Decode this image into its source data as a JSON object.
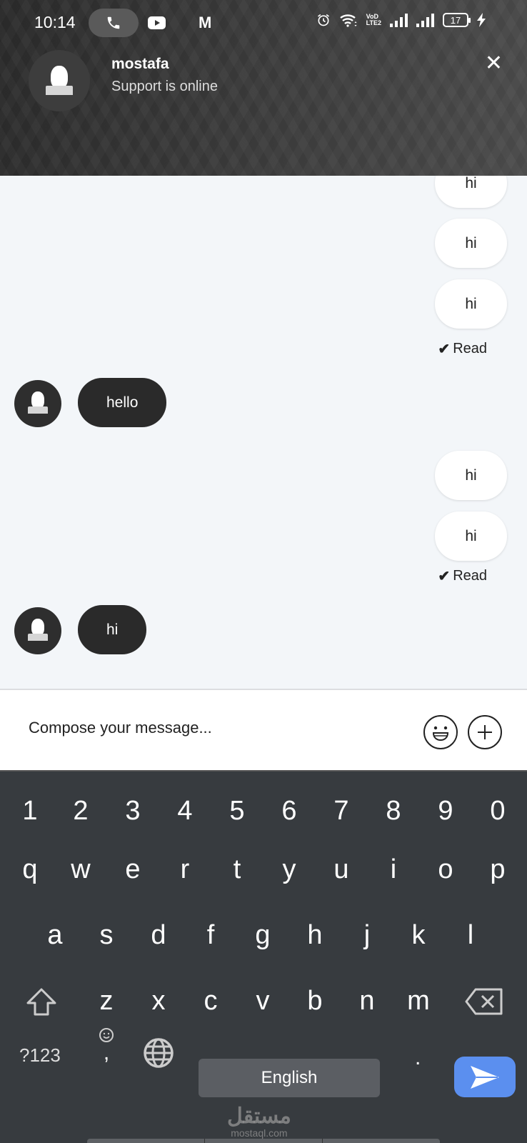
{
  "status_bar": {
    "time": "10:14",
    "left_icons": [
      "phone-call-icon",
      "youtube-icon",
      "gmail-icon"
    ],
    "right_icons": [
      "alarm-icon",
      "wifi-icon",
      "volte-icon",
      "signal-icon",
      "signal-icon",
      "battery-icon",
      "charging-icon"
    ],
    "volte_top": "VoD",
    "volte_bottom": "LTE2",
    "battery_level": "17"
  },
  "header": {
    "contact_name": "mostafa",
    "contact_status": "Support is online",
    "close_label": "✕"
  },
  "messages": [
    {
      "direction": "out",
      "text": "hi"
    },
    {
      "direction": "out",
      "text": "hi"
    },
    {
      "direction": "out",
      "text": "hi"
    },
    {
      "direction": "receipt",
      "text": "Read"
    },
    {
      "direction": "in",
      "text": "hello"
    },
    {
      "direction": "out",
      "text": "hi"
    },
    {
      "direction": "out",
      "text": "hi"
    },
    {
      "direction": "receipt",
      "text": "Read"
    },
    {
      "direction": "in",
      "text": "hi"
    }
  ],
  "composer": {
    "placeholder": "Compose your message...",
    "value": "",
    "emoji_button": "emoji-icon",
    "attach_button": "plus-icon"
  },
  "keyboard": {
    "number_row": [
      "1",
      "2",
      "3",
      "4",
      "5",
      "6",
      "7",
      "8",
      "9",
      "0"
    ],
    "row1": [
      "q",
      "w",
      "e",
      "r",
      "t",
      "y",
      "u",
      "i",
      "o",
      "p"
    ],
    "row2": [
      "a",
      "s",
      "d",
      "f",
      "g",
      "h",
      "j",
      "k",
      "l"
    ],
    "row3": [
      "z",
      "x",
      "c",
      "v",
      "b",
      "n",
      "m"
    ],
    "symbols_key": "?123",
    "comma_key": ",",
    "space_label": "English",
    "period_key": ".",
    "enter_color": "#5b8fef"
  },
  "watermark": {
    "arabic": "مستقل",
    "latin": "mostaql.com"
  }
}
